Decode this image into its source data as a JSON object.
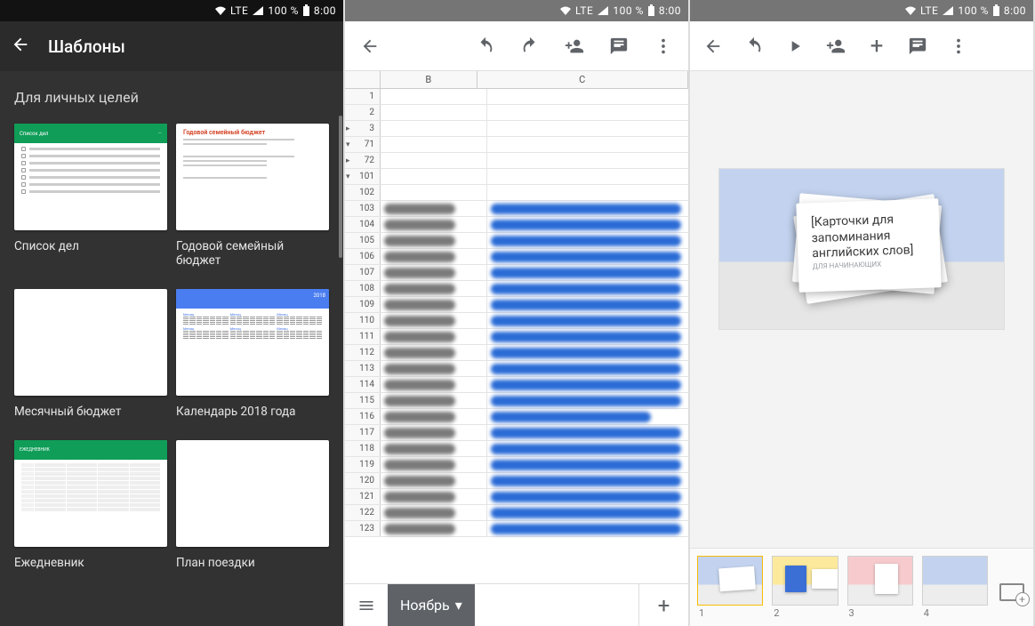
{
  "status": {
    "network": "LTE",
    "battery": "100 %",
    "time": "8:00"
  },
  "screen1": {
    "title": "Шаблоны",
    "section": "Для личных целей",
    "templates": [
      {
        "label": "Список дел",
        "kind": "todo",
        "thumb_title": "Список дел"
      },
      {
        "label": "Годовой семейный бюджет",
        "kind": "budget",
        "thumb_title": "Годовой семейный бюджет"
      },
      {
        "label": "Месячный бюджет",
        "kind": "blank",
        "thumb_title": ""
      },
      {
        "label": "Календарь 2018 года",
        "kind": "calendar",
        "thumb_title": "2018"
      },
      {
        "label": "Ежедневник",
        "kind": "planner",
        "thumb_title": "ЕЖЕДНЕВНИК"
      },
      {
        "label": "План поездки",
        "kind": "blank",
        "thumb_title": ""
      }
    ]
  },
  "screen2": {
    "columns": [
      "B",
      "C"
    ],
    "rows": [
      {
        "n": 1,
        "empty": true
      },
      {
        "n": 2,
        "empty": true
      },
      {
        "n": 3,
        "empty": true,
        "mark": "▸"
      },
      {
        "n": 71,
        "empty": true,
        "mark": "▾"
      },
      {
        "n": 72,
        "empty": true,
        "mark": "▸"
      },
      {
        "n": 101,
        "empty": true,
        "mark": "▾"
      },
      {
        "n": 102
      },
      {
        "n": 103,
        "data": true
      },
      {
        "n": 104,
        "data": true
      },
      {
        "n": 105,
        "data": true
      },
      {
        "n": 106,
        "data": true
      },
      {
        "n": 107,
        "data": true
      },
      {
        "n": 108,
        "data": true
      },
      {
        "n": 109,
        "data": true
      },
      {
        "n": 110,
        "data": true
      },
      {
        "n": 111,
        "data": true
      },
      {
        "n": 112,
        "data": true
      },
      {
        "n": 113,
        "data": true
      },
      {
        "n": 114,
        "data": true
      },
      {
        "n": 115,
        "data": true
      },
      {
        "n": 116,
        "data": true,
        "short": true
      },
      {
        "n": 117,
        "data": true
      },
      {
        "n": 118,
        "data": true
      },
      {
        "n": 119,
        "data": true
      },
      {
        "n": 120,
        "data": true
      },
      {
        "n": 121,
        "data": true
      },
      {
        "n": 122,
        "data": true
      },
      {
        "n": 123,
        "data": true
      }
    ],
    "active_tab": "Ноябрь"
  },
  "screen3": {
    "slide_title": "[Карточки для запоминания английских слов]",
    "slide_sub": "ДЛЯ НАЧИНАЮЩИХ",
    "thumbs": [
      {
        "n": 1,
        "color": "blue",
        "active": true
      },
      {
        "n": 2,
        "color": "yellow",
        "active": false
      },
      {
        "n": 3,
        "color": "pink",
        "active": false
      },
      {
        "n": 4,
        "color": "blue",
        "active": false
      }
    ]
  }
}
